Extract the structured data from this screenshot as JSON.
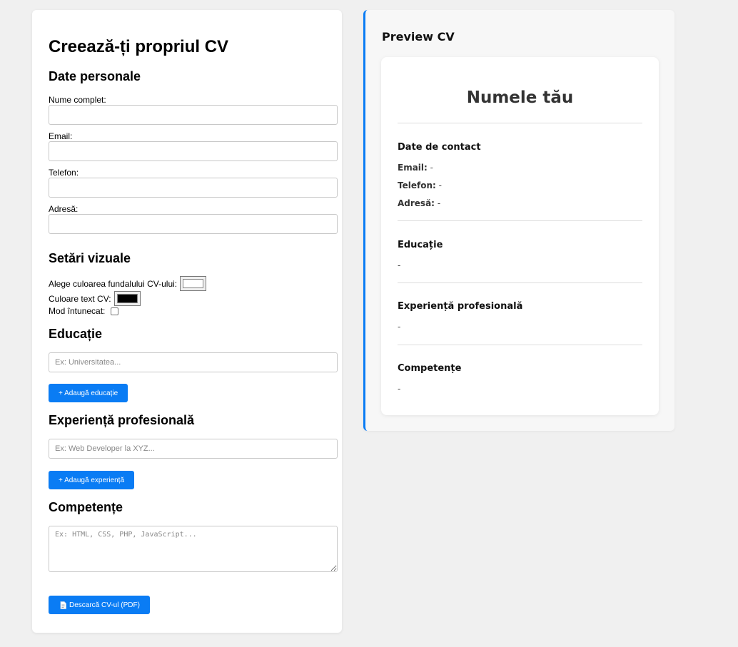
{
  "form": {
    "title": "Creează-ți propriul CV",
    "personal": {
      "heading": "Date personale",
      "name_label": "Nume complet:",
      "email_label": "Email:",
      "phone_label": "Telefon:",
      "address_label": "Adresă:",
      "name_value": "",
      "email_value": "",
      "phone_value": "",
      "address_value": ""
    },
    "visual": {
      "heading": "Setări vizuale",
      "bg_label": "Alege culoarea fundalului CV-ului:",
      "bg_color": "#ffffff",
      "text_label": "Culoare text CV:",
      "text_color": "#000000",
      "dark_label": "Mod întunecat:",
      "dark_checked": false
    },
    "education": {
      "heading": "Educație",
      "placeholder": "Ex: Universitatea...",
      "add_button": "+ Adaugă educație"
    },
    "experience": {
      "heading": "Experiență profesională",
      "placeholder": "Ex: Web Developer la XYZ...",
      "add_button": "+ Adaugă experiență"
    },
    "skills": {
      "heading": "Competențe",
      "placeholder": "Ex: HTML, CSS, PHP, JavaScript..."
    },
    "download_button": "Descarcă CV-ul (PDF)",
    "download_icon": "document-icon"
  },
  "preview": {
    "title": "Preview CV",
    "name": "Numele tău",
    "contact_heading": "Date de contact",
    "email_label": "Email:",
    "email_value": "-",
    "phone_label": "Telefon:",
    "phone_value": "-",
    "address_label": "Adresă:",
    "address_value": "-",
    "education_heading": "Educație",
    "education_value": "-",
    "experience_heading": "Experiență profesională",
    "experience_value": "-",
    "skills_heading": "Competențe",
    "skills_value": "-"
  },
  "colors": {
    "accent": "#0a7cf4",
    "page_bg": "#f0f0f0"
  }
}
